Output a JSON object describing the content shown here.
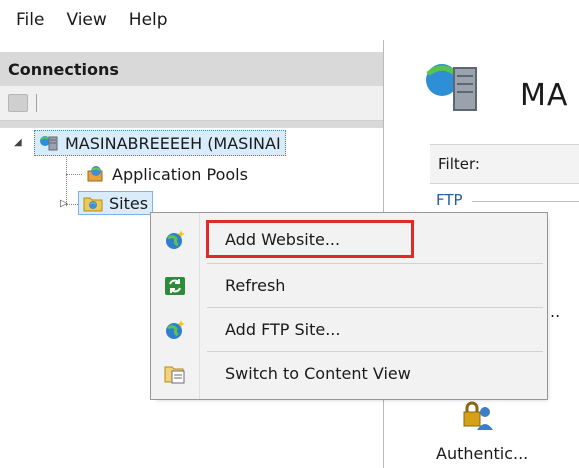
{
  "menubar": {
    "items": [
      "File",
      "View",
      "Help"
    ]
  },
  "connections": {
    "title": "Connections",
    "server_label": "MASINABREEEEH (MASINAI",
    "app_pools_label": "Application Pools",
    "sites_label": "Sites"
  },
  "right_pane": {
    "title": "MA",
    "filter_label": "Filter:",
    "ftp_label": "FTP",
    "partial_item": "..",
    "auth_label": "Authentic..."
  },
  "context_menu": {
    "items": [
      {
        "label": "Add Website...",
        "icon": "globe-add-icon"
      },
      {
        "label": "Refresh",
        "icon": "refresh-icon"
      },
      {
        "label": "Add FTP Site...",
        "icon": "globe-add-icon"
      },
      {
        "label": "Switch to Content View",
        "icon": "content-view-icon"
      }
    ]
  },
  "colors": {
    "highlight": "#e02a2a",
    "selection": "#d9ecfb",
    "link": "#1f5fa8"
  }
}
